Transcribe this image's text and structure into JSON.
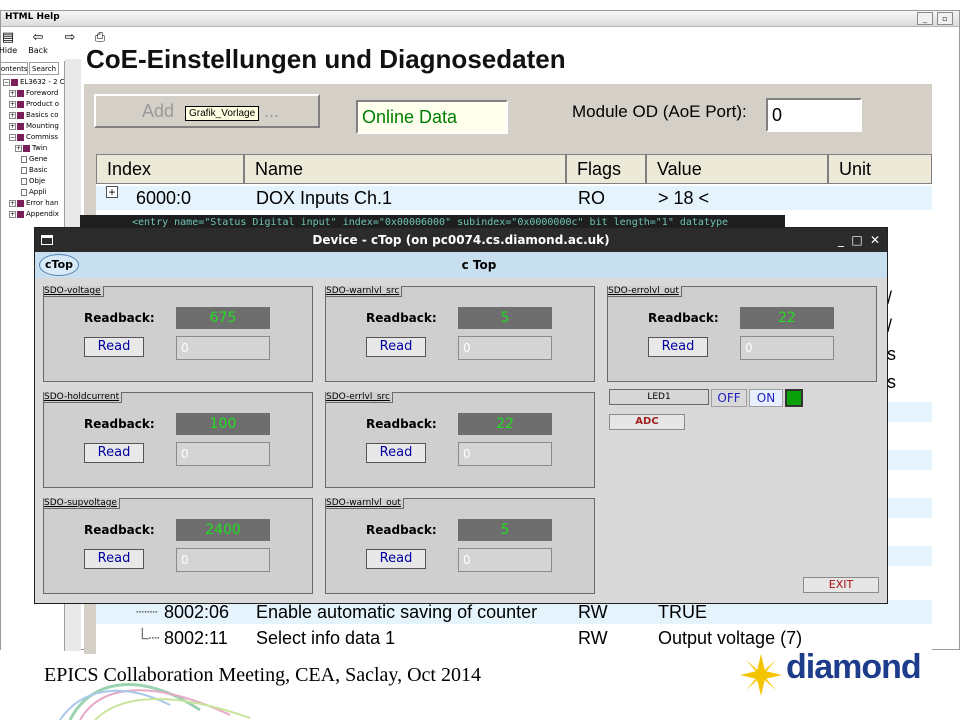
{
  "help_window": {
    "title": "HTML Help",
    "toolbar": {
      "hide_label": "Hide",
      "back_label": "Back"
    },
    "tabs": [
      "Contents",
      "Search"
    ],
    "tree": [
      {
        "label": "EL3632 - 2 C",
        "level": 0,
        "type": "book",
        "expander": "−"
      },
      {
        "label": "Foreword",
        "level": 1,
        "type": "book",
        "expander": "+"
      },
      {
        "label": "Product o",
        "level": 1,
        "type": "book",
        "expander": "+"
      },
      {
        "label": "Basics co",
        "level": 1,
        "type": "book",
        "expander": "+"
      },
      {
        "label": "Mounting",
        "level": 1,
        "type": "book",
        "expander": "+"
      },
      {
        "label": "Commiss",
        "level": 1,
        "type": "book",
        "expander": "−"
      },
      {
        "label": "Twin",
        "level": 2,
        "type": "book",
        "expander": "+"
      },
      {
        "label": "Gene",
        "level": 3,
        "type": "page",
        "expander": ""
      },
      {
        "label": "Basic",
        "level": 3,
        "type": "page",
        "expander": ""
      },
      {
        "label": "Obje",
        "level": 3,
        "type": "page",
        "expander": ""
      },
      {
        "label": "Appli",
        "level": 3,
        "type": "page",
        "expander": ""
      },
      {
        "label": "Error han",
        "level": 1,
        "type": "book",
        "expander": "+"
      },
      {
        "label": "Appendix",
        "level": 1,
        "type": "book",
        "expander": "+"
      }
    ]
  },
  "coe": {
    "page_title": "CoE-Einstellungen und Diagnosedaten",
    "add_button_label": "Add",
    "add_button_suffix": "...",
    "tooltip": "Grafik_Vorlage",
    "online_data": "Online Data",
    "module_od_label": "Module OD (AoE Port):",
    "module_od_value": "0",
    "columns": [
      "Index",
      "Name",
      "Flags",
      "Value",
      "Unit"
    ],
    "rows": [
      {
        "index": "6000:0",
        "name": "DOX Inputs Ch.1",
        "flags": "RO",
        "value": "> 18 <",
        "expander": "+"
      },
      {
        "index": "8002:06",
        "name": "Enable automatic saving of counter",
        "flags": "RW",
        "value": "TRUE",
        "expander": ""
      },
      {
        "index": "8002:11",
        "name": "Select info data 1",
        "flags": "RW",
        "value": "Output voltage (7)",
        "expander": ""
      }
    ],
    "xml_snippet": "<entry name=\"Status  Digital input\" index=\"0x00006000\" subindex=\"0x0000000c\" bit_length=\"1\" datatype",
    "side_glyphs": [
      "/",
      "/",
      "s",
      "s"
    ]
  },
  "device_window": {
    "title": "Device - cTop (on pc0074.cs.diamond.ac.uk)",
    "controls": [
      "_",
      "□",
      "✕"
    ],
    "tab_label": "cTop",
    "panel_title": "c Top",
    "groups": [
      {
        "label": "SDO-voltage",
        "readback_label": "Readback:",
        "readback_value": "675",
        "read_label": "Read",
        "input_value": "0"
      },
      {
        "label": "SDO-warnlvl_src",
        "readback_label": "Readback:",
        "readback_value": "5",
        "read_label": "Read",
        "input_value": "0"
      },
      {
        "label": "SDO-errolvl_out",
        "readback_label": "Readback:",
        "readback_value": "22",
        "read_label": "Read",
        "input_value": "0"
      },
      {
        "label": "SDO-holdcurrent",
        "readback_label": "Readback:",
        "readback_value": "100",
        "read_label": "Read",
        "input_value": "0"
      },
      {
        "label": "SDO-errlvl_src",
        "readback_label": "Readback:",
        "readback_value": "22",
        "read_label": "Read",
        "input_value": "0"
      },
      {
        "label": "SDO-supvoltage",
        "readback_label": "Readback:",
        "readback_value": "2400",
        "read_label": "Read",
        "input_value": "0"
      },
      {
        "label": "SDO-warnlvl_out",
        "readback_label": "Readback:",
        "readback_value": "5",
        "read_label": "Read",
        "input_value": "0"
      }
    ],
    "led": {
      "label": "LED1",
      "off_label": "OFF",
      "on_label": "ON",
      "state": "on",
      "color": "#0aa00a"
    },
    "adc_label": "ADC",
    "exit_label": "EXIT"
  },
  "footer": {
    "text": "EPICS Collaboration Meeting, CEA, Saclay, Oct 2014",
    "logo_text": "diamond"
  },
  "colors": {
    "readback_text": "#22dd22",
    "readback_bg": "#6e6e6e",
    "logo_blue": "#1e3c8c",
    "logo_yellow": "#f5c400"
  }
}
